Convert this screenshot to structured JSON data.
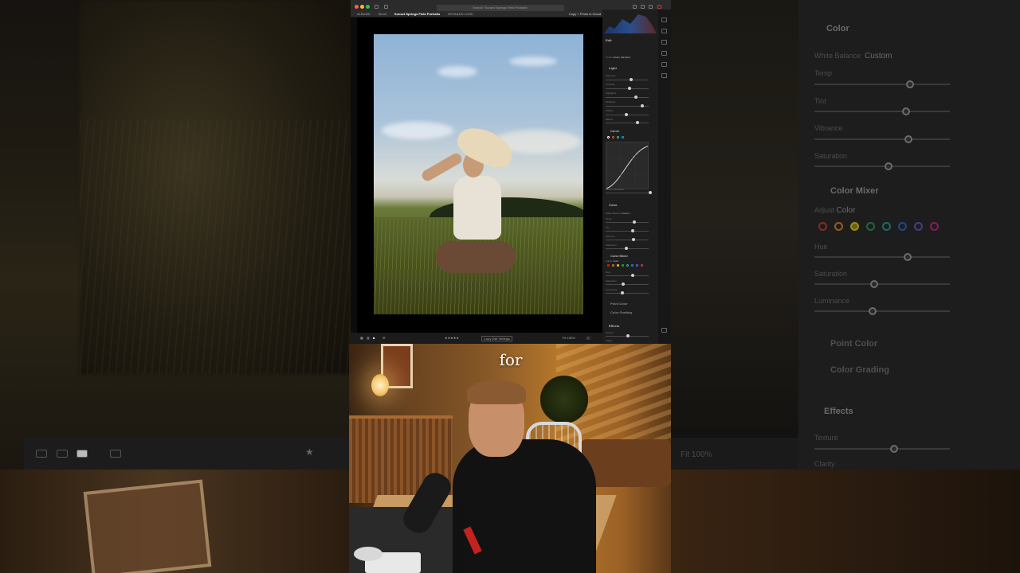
{
  "caption": "for",
  "app": {
    "search_text": "Search \"Sunset Springs Field Portraits\"",
    "breadcrumb": [
      "ALBUMS",
      "Shoot",
      "Sunset Springs Field Portraits",
      "DETAILED LOOK"
    ],
    "share_label": "Copy + Photo in Cloud",
    "filmstrip": {
      "copy_label": "Copy Edit Settings",
      "zoom": "Fit 100%"
    },
    "panel": {
      "edit_title": "Edit",
      "profile_label": "Profile",
      "profile_value": "Adobe Standard",
      "light_title": "Light",
      "light_sliders": [
        "Exposure",
        "Contrast",
        "Highlights",
        "Shadows",
        "Whites",
        "Blacks"
      ],
      "curve_title": "Curve",
      "refine_saturation": "Refine Saturation",
      "color_title": "Color",
      "white_balance_label": "White Balance",
      "white_balance_value": "Custom",
      "color_sliders": [
        "Temp",
        "Tint",
        "Vibrance",
        "Saturation"
      ],
      "color_mixer_title": "Color Mixer",
      "adjust_label": "Adjust",
      "adjust_value": "Color",
      "mixer_sliders": [
        "Hue",
        "Saturation",
        "Luminance"
      ],
      "point_color_title": "Point Color",
      "color_grading_title": "Color Grading",
      "effects_title": "Effects",
      "effects_sliders": [
        "Texture",
        "Clarity"
      ]
    }
  },
  "background_panel": {
    "color_title": "Color",
    "white_balance_label": "White Balance",
    "white_balance_value": "Custom",
    "temp_label": "Temp",
    "tint_label": "Tint",
    "vibrance_label": "Vibrance",
    "saturation_label": "Saturation",
    "color_mixer_title": "Color Mixer",
    "adjust_label": "Adjust",
    "adjust_value": "Color",
    "hue_label": "Hue",
    "mixer_saturation_label": "Saturation",
    "luminance_label": "Luminance",
    "point_color_title": "Point Color",
    "color_grading_title": "Color Grading",
    "effects_title": "Effects",
    "texture_label": "Texture",
    "clarity_label": "Clarity",
    "zoom_label": "Fit",
    "zoom_value": "100%"
  },
  "colors": {
    "mixer_dots": [
      "#c0392b",
      "#e67e22",
      "#f1c40f",
      "#27ae60",
      "#1abc9c",
      "#2e86de",
      "#6c5ce7",
      "#d6308a"
    ]
  }
}
